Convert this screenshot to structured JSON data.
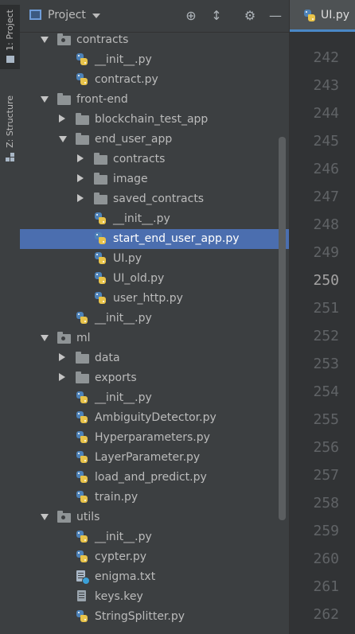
{
  "sidebar_tabs": [
    {
      "label": "1: Project",
      "icon": "folder-icon"
    },
    {
      "label": "Z: Structure",
      "icon": "structure-icon"
    }
  ],
  "panel": {
    "title": "Project",
    "buttons": [
      "locate-icon",
      "collapse-all-icon",
      "settings-icon",
      "hide-icon"
    ]
  },
  "tree": [
    {
      "label": "contracts",
      "type": "package",
      "expanded": true
    },
    {
      "label": "__init__.py",
      "type": "py"
    },
    {
      "label": "contract.py",
      "type": "py"
    },
    {
      "label": "front-end",
      "type": "folder",
      "expanded": true
    },
    {
      "label": "blockchain_test_app",
      "type": "folder",
      "expanded": false
    },
    {
      "label": "end_user_app",
      "type": "folder",
      "expanded": true
    },
    {
      "label": "contracts",
      "type": "folder",
      "expanded": false
    },
    {
      "label": "image",
      "type": "folder",
      "expanded": false
    },
    {
      "label": "saved_contracts",
      "type": "folder",
      "expanded": false
    },
    {
      "label": "__init__.py",
      "type": "py"
    },
    {
      "label": "start_end_user_app.py",
      "type": "py",
      "selected": true
    },
    {
      "label": "UI.py",
      "type": "py"
    },
    {
      "label": "UI_old.py",
      "type": "py"
    },
    {
      "label": "user_http.py",
      "type": "py"
    },
    {
      "label": "__init__.py",
      "type": "py"
    },
    {
      "label": "ml",
      "type": "package",
      "expanded": true
    },
    {
      "label": "data",
      "type": "folder",
      "expanded": false
    },
    {
      "label": "exports",
      "type": "folder",
      "expanded": false
    },
    {
      "label": "__init__.py",
      "type": "py"
    },
    {
      "label": "AmbiguityDetector.py",
      "type": "py"
    },
    {
      "label": "Hyperparameters.py",
      "type": "py"
    },
    {
      "label": "LayerParameter.py",
      "type": "py"
    },
    {
      "label": "load_and_predict.py",
      "type": "py"
    },
    {
      "label": "train.py",
      "type": "py"
    },
    {
      "label": "utils",
      "type": "package",
      "expanded": true
    },
    {
      "label": "__init__.py",
      "type": "py"
    },
    {
      "label": "cypter.py",
      "type": "py"
    },
    {
      "label": "enigma.txt",
      "type": "txt"
    },
    {
      "label": "keys.key",
      "type": "key"
    },
    {
      "label": "StringSplitter.py",
      "type": "py"
    }
  ],
  "editor": {
    "tab_label": "UI.py",
    "line_numbers": [
      "242",
      "243",
      "244",
      "245",
      "246",
      "247",
      "248",
      "249",
      "250",
      "251",
      "252",
      "253",
      "254",
      "255",
      "256",
      "257",
      "258",
      "259",
      "260",
      "261",
      "262"
    ],
    "current_line": "250"
  },
  "colors": {
    "panel_bg": "#3c3f41",
    "editor_bg": "#2b2b2b",
    "selection": "#4b6eaf",
    "accent": "#4a88c7"
  }
}
